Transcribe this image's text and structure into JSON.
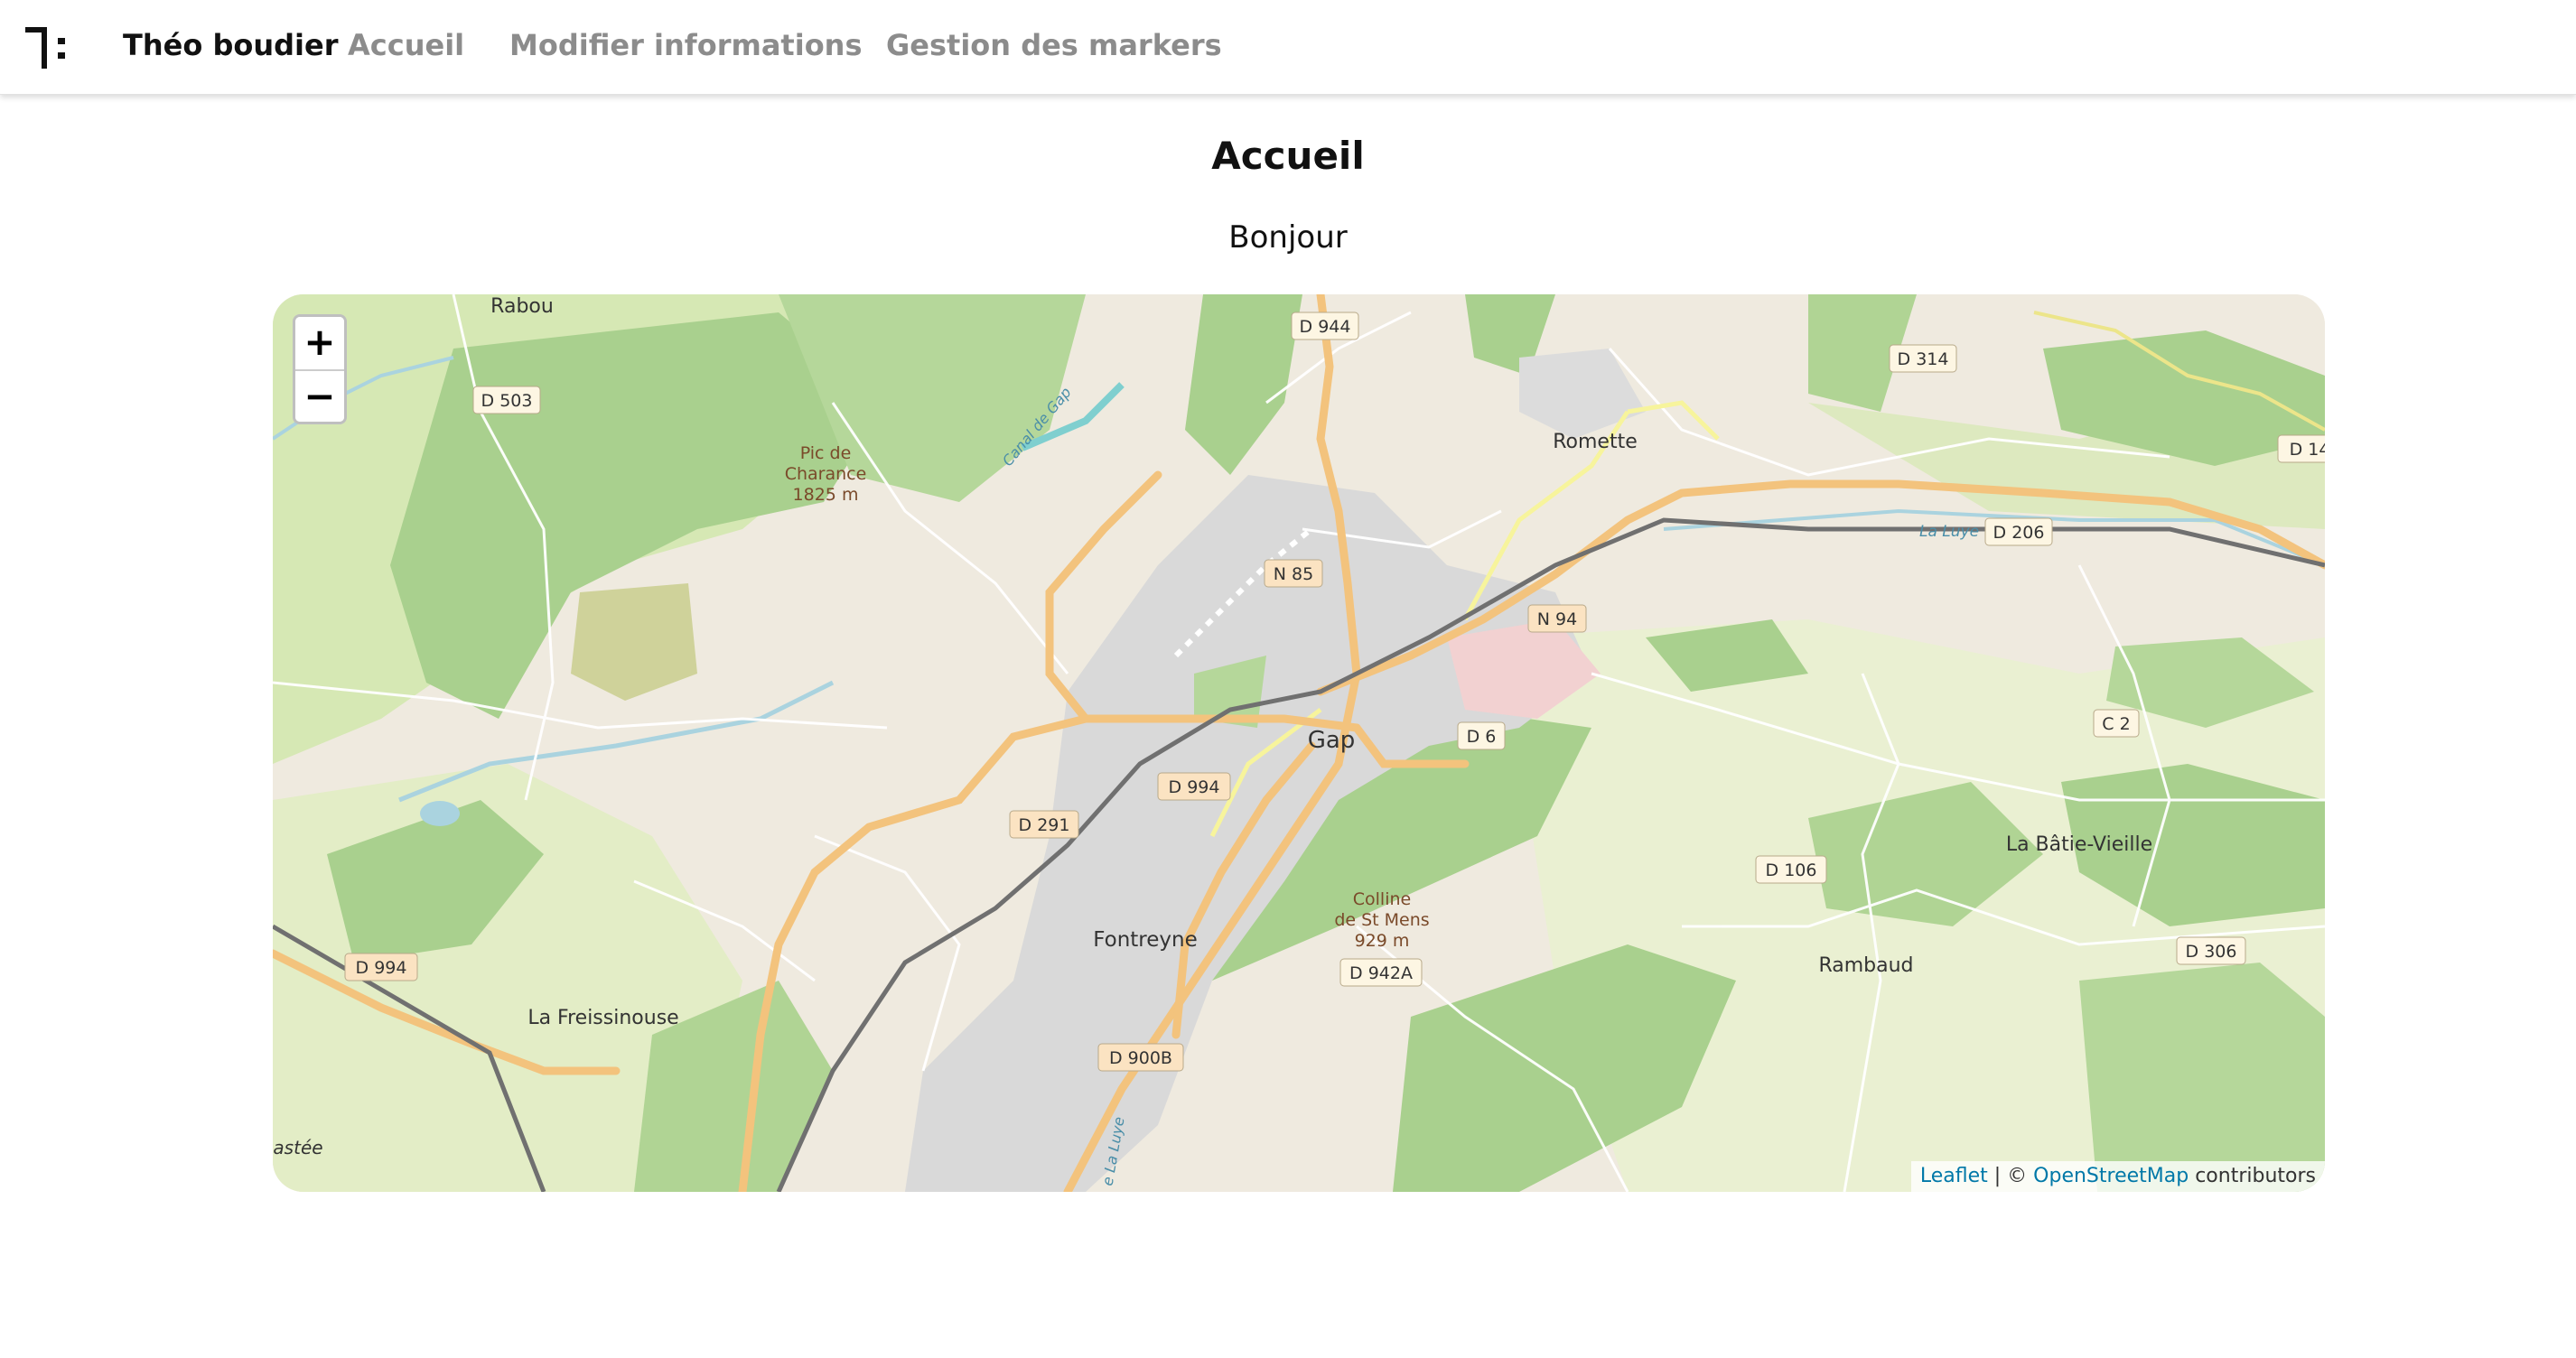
{
  "navbar": {
    "brand": "Théo boudier",
    "links": [
      "Accueil",
      "Modifier informations",
      "Gestion des markers"
    ]
  },
  "page": {
    "title": "Accueil",
    "greeting": "Bonjour"
  },
  "map": {
    "zoom_in": "+",
    "zoom_out": "−",
    "attribution": {
      "leaflet": "Leaflet",
      "separator": " | © ",
      "osm": "OpenStreetMap",
      "suffix": " contributors"
    },
    "places": {
      "rabou": "Rabou",
      "pic": [
        "Pic de",
        "Charance",
        "1825 m"
      ],
      "romette": "Romette",
      "gap": "Gap",
      "fontreyne": "Fontreyne",
      "colline": [
        "Colline",
        "de St Mens",
        "929 m"
      ],
      "la_batie": "La Bâtie-Vieille",
      "rambaud": "Rambaud",
      "la_freissinouse": "La Freissinouse",
      "astee": "astée",
      "canal": "Canal de Gap",
      "la_luye": "La Luye",
      "la_luye2": "e La Luye"
    },
    "roads": {
      "d503": "D 503",
      "d944": "D 944",
      "d314": "D 314",
      "d14": "D 14",
      "d206": "D 206",
      "n85": "N 85",
      "n94": "N 94",
      "d6": "D 6",
      "c2": "C 2",
      "d994a": "D 994",
      "d994b": "D 994",
      "d291": "D 291",
      "d106": "D 106",
      "d306": "D 306",
      "d942a": "D 942A",
      "d900b": "D 900B"
    },
    "colors": {
      "land": "#efeadf",
      "forest": "#a9d08e",
      "meadow": "#d6e8b4",
      "urban": "#d9d9d9",
      "road_major": "#f3c37d",
      "road_minor": "#ffffff",
      "water": "#aad3df"
    }
  }
}
